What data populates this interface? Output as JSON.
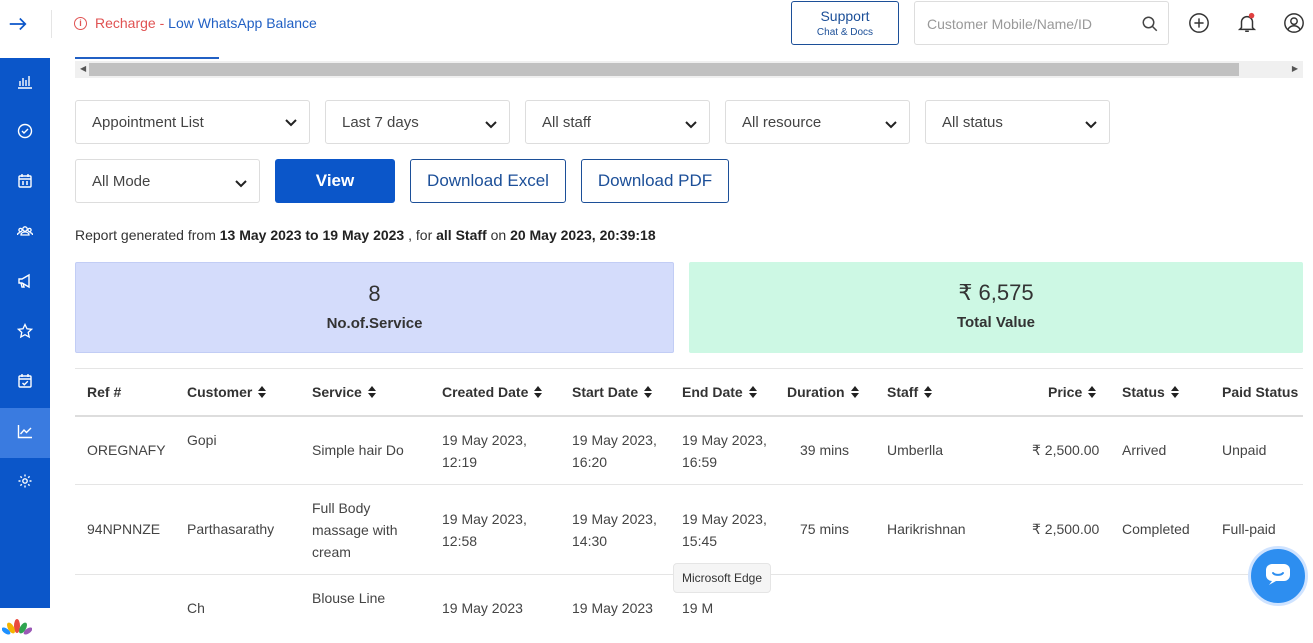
{
  "topbar": {
    "recharge_prefix": "Recharge",
    "recharge_sep": " - ",
    "recharge_link": "Low WhatsApp Balance",
    "support_title": "Support",
    "support_sub": "Chat & Docs",
    "search_placeholder": "Customer Mobile/Name/ID"
  },
  "sidebar": {
    "items": [
      {
        "icon": "bar-chart-icon"
      },
      {
        "icon": "check-circle-icon"
      },
      {
        "icon": "calendar-icon"
      },
      {
        "icon": "users-icon"
      },
      {
        "icon": "megaphone-icon"
      },
      {
        "icon": "star-icon"
      },
      {
        "icon": "calendar-check-icon"
      },
      {
        "icon": "trend-chart-icon",
        "active": true
      },
      {
        "icon": "gear-icon"
      }
    ]
  },
  "filters": {
    "report_type": "Appointment List",
    "range": "Last 7 days",
    "staff": "All staff",
    "resource": "All resource",
    "status": "All status",
    "mode": "All Mode",
    "view_label": "View",
    "excel_label": "Download Excel",
    "pdf_label": "Download PDF"
  },
  "report": {
    "prefix": "Report generated from ",
    "from": "13 May 2023",
    "to_word": " to ",
    "to": "19 May 2023",
    "for_word": " , for ",
    "staff": "all Staff",
    "on_word": " on ",
    "generated": "20 May 2023, 20:39:18"
  },
  "cards": {
    "services_value": "8",
    "services_label": "No.of.Service",
    "total_value": "₹ 6,575",
    "total_label": "Total Value"
  },
  "table": {
    "headers": [
      "Ref #",
      "Customer",
      "Service",
      "Created Date",
      "Start Date",
      "End Date",
      "Duration",
      "Staff",
      "Price",
      "Status",
      "Paid Status"
    ],
    "rows": [
      {
        "ref": "OREGNAFY",
        "customer": "Gopi",
        "service": "Simple hair Do",
        "created": "19 May 2023, 12:19",
        "start": "19 May 2023, 16:20",
        "end": "19 May 2023, 16:59",
        "duration": "39 mins",
        "staff": "Umberlla",
        "price": "₹ 2,500.00",
        "status": "Arrived",
        "paid": "Unpaid"
      },
      {
        "ref": "94NPNNZE",
        "customer": "Parthasarathy",
        "service": "Full Body massage with cream",
        "created": "19 May 2023, 12:58",
        "start": "19 May 2023, 14:30",
        "end": "19 May 2023, 15:45",
        "duration": "75 mins",
        "staff": "Harikrishnan",
        "price": "₹ 2,500.00",
        "status": "Completed",
        "paid": "Full-paid"
      },
      {
        "ref": "",
        "customer": "Ch",
        "service": "Blouse Line",
        "created": "19 May 2023",
        "start": "19 May 2023",
        "end": "19 M",
        "duration": "",
        "staff": "",
        "price": "",
        "status": "",
        "paid": ""
      }
    ]
  },
  "tooltip": "Microsoft Edge"
}
